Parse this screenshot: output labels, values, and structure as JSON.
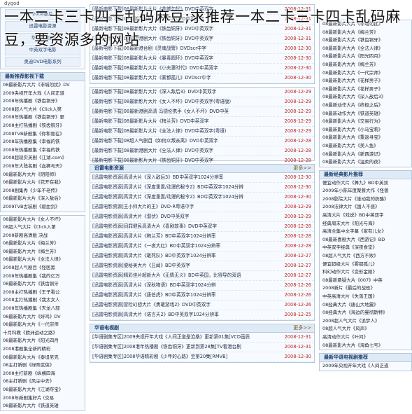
{
  "overlay_title": "一本二卡三卡四卡乱码麻豆;求推荐一本二卡三卡四卡乱码麻豆，要资源多的网站",
  "site_fragment": "dygod",
  "left": {
    "nav": [
      "2008新片",
      "迅雷电影资源",
      "华语电视剧",
      "中英双字电影",
      "奥迪DVD电影系列"
    ],
    "recommend_title": "最新推荐影视下载",
    "recommend": [
      "08最新影片大片《非城勿扰》DV",
      "2009央视开年大戏《人间正道",
      "2008年热播剧《铁齿铜牙》",
      "2008超人气大片《Click入第",
      "2008年热播剧《铁齿铜牙》更",
      "2008主打热播剧《铁齿铜牙》",
      "2008TVB新剧集《你和谁在》",
      "2008年热播剧集《幸福的铁",
      "2008年热播剧集《幸福的铁",
      "2008超现实英剧《江湖.com》",
      "2008年大陆名剧《血狮与天》",
      "08最新影片大片《阴阳师》",
      "08最新影片大片《花开在我》",
      "2008剧集秀《少年不老传》",
      "08最新影片大片《深入敌后》",
      "2009TVB古装剧《碧血剑》"
    ],
    "list2": [
      "08最新影片大片《女人不坏》",
      "08超人气大片《Click入第",
      "2008新剧高清版 决战",
      "08最新影片大片《梅兰芳》",
      "08最新影片大片《梅兰芳》",
      "08最新影片大片《全法人律》",
      "2008超人气剧目《怪医黑",
      "2008年热播剧集《我的亿万",
      "08最新影片大片《铁齿铜牙",
      "2008主打热播剧《王子看公",
      "2008主打热播剧《我太女人",
      "2008年热播剧集《天龙八部",
      "08最新影片大片《好鸡》DV",
      "08最新影片大片《一代宗师",
      "十月科教《欧洲运动之路》",
      "08最新影片大片《阳光四月",
      "2008港剧集全新的精彩",
      "08最新影片大片《泰坦尼克",
      "08主打新剧《绿骨武侠》",
      "2008主打新剧《纵横四海",
      "08主打新剧《风尘中去》",
      "08最新影片大片《江湖夺宝》",
      "2008年新剧集好片 (交易",
      "08最新影片大片《铁道英雄"
    ]
  },
  "mid": {
    "top_rows": [
      {
        "title": "[最新电影下载]08最新影片大片《非城勿扰》DVD中英双字",
        "date": "2008-12-31"
      },
      {
        "title": "[最新电影下载]08最新港台剧《梅兰芳》DVD中英双字",
        "date": "2008-12-31"
      },
      {
        "title": "[最新电影下载]08最新影片大片《铁齿铜牙》DVD中英双字",
        "date": "2008-12-31"
      },
      {
        "title": "[最新电影下载]08最新港剧大片《铁齿铜牙》DVD中英双字",
        "date": "2008-12-31"
      },
      {
        "title": "[最新电影下载]08最新港台剧《灵魂战警》DVDscr中字",
        "date": "2008-12-30"
      },
      {
        "title": "[最新电影下载]08最新影片大片《暴毒圆环》DVD中英双字",
        "date": "2008-12-30"
      },
      {
        "title": "[最新电影下载]08最新影片大片《小夫妻时代》DVD中英双字",
        "date": "2008-12-30"
      },
      {
        "title": "[最新电影下载]08最新影片大片《雾都孤儿》DVDscr中字",
        "date": "2008-12-30"
      }
    ],
    "mid_rows": [
      {
        "title": "[最新电影下载]08最新影片大片《深入敌后3》DVD中英双字",
        "date": "2008-12-29"
      },
      {
        "title": "[最新电影下载]08最新影片大片《女人不坏》DVD中英双字(粤语版)",
        "date": "2008-12-29"
      },
      {
        "title": "[最新电影下载]08最新港剧高清 冯德伦携手《女人不坏》DVD中英",
        "date": "2008-12-29"
      },
      {
        "title": "[最新电影下载]08最新影片大片《梅兰芳》DVD中英双字",
        "date": "2008-12-29"
      },
      {
        "title": "[最新电影下载]08最新影片大片《全法人律》DVD中英双字(粤语)",
        "date": "2008-12-29"
      },
      {
        "title": "[最新电影下载]08超人气剧目《如何众叛亲离》DVD中英双字",
        "date": "2008-12-28"
      },
      {
        "title": "[最新电影下载]08最新港剧大片《全法人律》DVD中英双字",
        "date": "2008-12-28"
      },
      {
        "title": "[最新电影下载]08最新影片大片《铁齿铜牙》DVD中英双字",
        "date": "2008-12-28"
      }
    ],
    "xunlei_title": "迅雷电影资源",
    "xunlei_more": "更多>>",
    "xunlei_rows": [
      {
        "title": "[迅雷电影资源]高清大片《深入敌后3》BD中英双字1024分辨率",
        "date": "2008-12-30"
      },
      {
        "title": "[迅雷电影资源]高清大片《深度重置/动漫的秘令2》BD中英双字1024分辨",
        "date": "2008-12-30"
      },
      {
        "title": "[迅雷电影资源]高清大片《深度重置/动漫的秘令2》BD中英双字1024分辨",
        "date": "2008-12-30"
      },
      {
        "title": "[迅雷电影资源]王小帅大片的王》DVD-R粤语中字",
        "date": "2008-12-29"
      },
      {
        "title": "[迅雷电影资源]高清大片《潜伏》DVD中英双字",
        "date": "2008-12-29"
      },
      {
        "title": "[迅雷电影资源]同罪健民高清大片《喜剧故事》DVD中英双字",
        "date": "2008-12-28"
      },
      {
        "title": "[迅雷电影资源]高清大片《梅兰芳》BD中英双字1024分辨率",
        "date": "2008-12-28"
      },
      {
        "title": "[迅雷电影资源]高清大片《一夜大红》BD中英双字1024分辨率",
        "date": "2008-12-28"
      },
      {
        "title": "[迅雷电影资源]高清大片《敢死队》BD中英双字1024分辨率",
        "date": "2008-12-27"
      },
      {
        "title": "[迅雷电影资源]便秘美大片《丑闻》BD中英双字",
        "date": "2008-12-27"
      },
      {
        "title": "[迅雷电影资源]精彩佳片超新大片《无情无义》BD中英国，比得导的双语",
        "date": "2008-12-27"
      },
      {
        "title": "[迅雷电影资源]高清大片《深秋物语》BD中英双字1024分辨",
        "date": "2008-12-26"
      },
      {
        "title": "[迅雷电影资源]高清大片《唐伯虎》BD中英双字1024分辨率",
        "date": "2008-12-26"
      },
      {
        "title": "[迅雷电影资源]冒险幻想大片《勇敢游戏2》DVD中英双字",
        "date": "2008-12-26"
      },
      {
        "title": "[迅雷电影资源]高清大片《诺言天2》BD中英双字1024分辨率",
        "date": "2008-12-25"
      }
    ],
    "tv_title": "华语电视剧",
    "tv_more": "更多>>",
    "tv_rows": [
      {
        "title": "[华语剧集专区]2009央视开年大戏《人间正道是沧桑》更新第01集[VCD画质",
        "date": "2008-12-31"
      },
      {
        "title": "[华语剧集专区]2008港年热播剧《铁齿铜牙》更新到第28集[TV看港台剧",
        "date": "2008-12-31"
      },
      {
        "title": "[华语剧集专区]2008华语精彩剧《少年的心路》至第20集[RMVB]",
        "date": "2008-12-30"
      }
    ]
  },
  "right": {
    "top_list": [
      "08最新影片大片《非城勿扰》",
      "08最新影片大片《梅兰芳》",
      "08最新影片大片《铁齿铜牙》",
      "08最新影片大片《全法人律》",
      "08最新影片大片《阳光四月》",
      "08最新影片大片《梅兰芳》",
      "08最新影片大片《一代宗师》",
      "08最新影片大片《花样男子》",
      "08最新影片大片《花样男子》",
      "08最新影片大片《深入敌后3》",
      "08最新动作大片《终极之后》",
      "08最新动作大片《铁道英雄》",
      "08最新影片大片《交易行为》",
      "08最新影片大片《小马宝莉》",
      "08最新影片大片《重返寻宝》",
      "08最新影片大片《美人鱼》",
      "08最新影片大片《新西游记》",
      "08最新影片大片《温柔的夜》"
    ],
    "classic_title": "最新经典影片推荐",
    "classic": [
      "便宜动作大片《舞九》BD中英双",
      "2009年小陈年度聚餐大作《怪兽",
      "2008影院大片《谁动我的奶酪》",
      "2008法律大片《国人不惑》",
      "高清大片《戏说》BD中英双字",
      "经典周末大片《阳光与海》",
      "高清全集中文字幕《家有儿女》",
      "08最新喜剧大片《西游记》BD",
      "中英双字经典《深夜食堂》",
      "08超人气大片《西方不败》",
      "便宜超级大片《雾都孤儿》",
      "科幻动作大片《变形金刚》",
      "08最新悬疑大片《007》中英",
      "2008新片《最后的战役》",
      "中英高清大片《失落王国》",
      "08经典大片《唐山大地震》",
      "08经典大片《海边的曼彻斯特》",
      "2008超人气大片《追梦人》",
      "08超人气大片《风声》",
      "高清动作大片《叶问》",
      "08最新影片大片《海角七号》"
    ],
    "tv_title": "最新华语电视剧推荐",
    "tv": [
      "2009年央视开年大戏《人间正道"
    ]
  }
}
